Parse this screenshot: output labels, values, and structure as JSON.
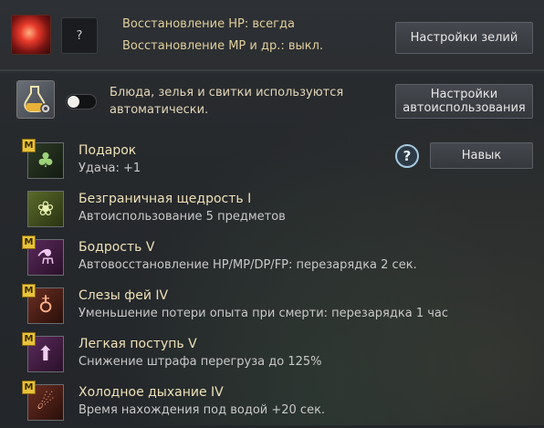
{
  "potions": {
    "hp_line": "Восстановление HP: всегда",
    "mp_line": "Восстановление MP и др.: выкл.",
    "slot_label": "?",
    "settings_button": "Настройки зелий"
  },
  "auto_use": {
    "description": "Блюда, зелья и свитки используются автоматически.",
    "toggle_state": "off",
    "settings_button": "Настройки автоиспользования"
  },
  "skill_button": "Навык",
  "help_label": "?",
  "skills": [
    {
      "name": "Подарок",
      "desc": "Удача: +1",
      "badge": "M",
      "icon": "clover-icon"
    },
    {
      "name": "Безграничная щедрость I",
      "desc": "Автоиспользование 5 предметов",
      "badge": "",
      "icon": "fairy-icon"
    },
    {
      "name": "Бодрость V",
      "desc": "Автовосстановление HP/MP/DP/FP: перезарядка 2 сек.",
      "badge": "M",
      "icon": "potions-icon"
    },
    {
      "name": "Слезы фей IV",
      "desc": "Уменьшение потери опыта при смерти: перезарядка 1 час",
      "badge": "M",
      "icon": "tears-vial-icon"
    },
    {
      "name": "Легкая поступь V",
      "desc": "Снижение штрафа перегруза до 125%",
      "badge": "M",
      "icon": "weight-icon"
    },
    {
      "name": "Холодное дыхание IV",
      "desc": "Время нахождения под водой +20 сек.",
      "badge": "M",
      "icon": "cold-breath-icon"
    }
  ]
}
